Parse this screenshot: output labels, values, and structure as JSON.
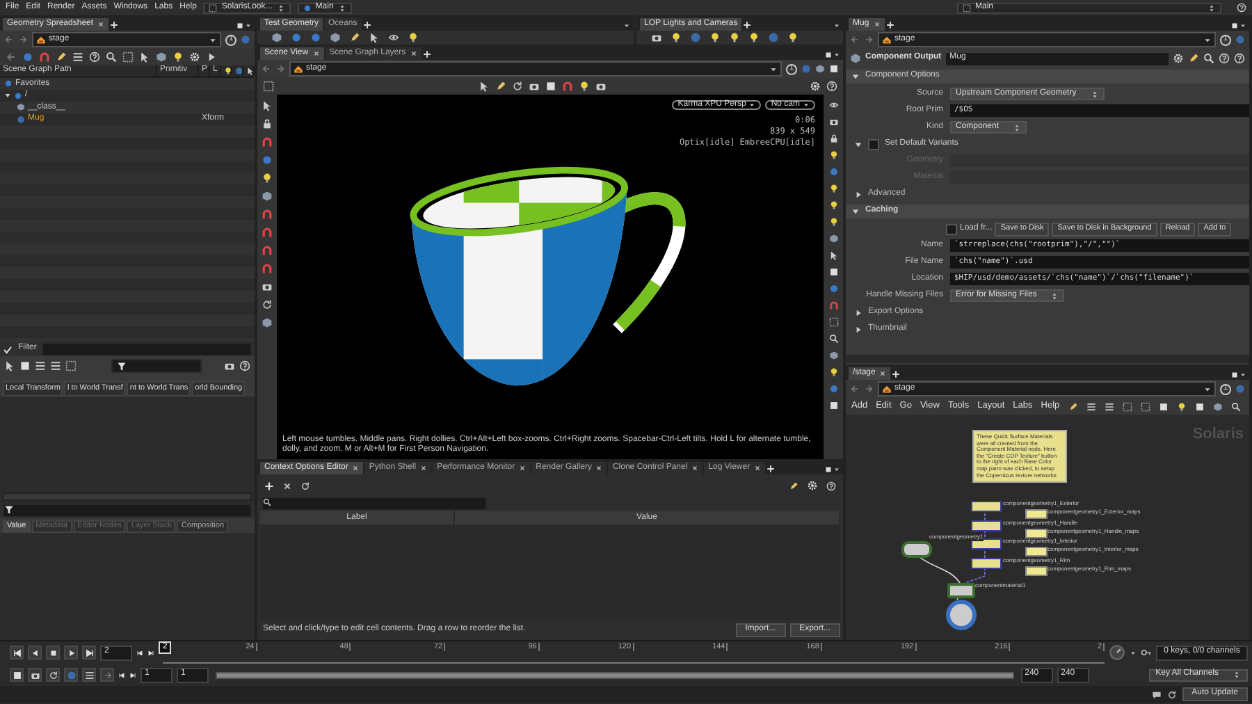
{
  "menubar": {
    "items": [
      "File",
      "Edit",
      "Render",
      "Assets",
      "Windows",
      "Labs",
      "Help"
    ],
    "desktop": "SolarisLook...",
    "context": "Main",
    "context_right": "Main"
  },
  "scene_graph": {
    "tabs": [
      {
        "label": "Geometry Spreadsheet",
        "selected": true
      }
    ],
    "path": "stage",
    "path_badge": "1",
    "columns": [
      "Scene Graph Path",
      "Primitiv",
      "P",
      "L"
    ],
    "tree": [
      {
        "label": "Favorites",
        "highlighted": false
      },
      {
        "label": "/",
        "highlighted": false,
        "children": [
          {
            "label": "__class__",
            "highlighted": false
          },
          {
            "label": "Mug",
            "type": "Xform",
            "highlighted": true
          }
        ]
      }
    ],
    "filter_label": "Filter"
  },
  "inspector": {
    "columns": [
      "Local Transform",
      "l to World Transf",
      "nt to World Trans",
      "orld Bounding"
    ],
    "tabs": [
      {
        "label": "Value",
        "selected": true,
        "disabled": false
      },
      {
        "label": "Metadata",
        "selected": false,
        "disabled": true
      },
      {
        "label": "Editor Nodes",
        "selected": false,
        "disabled": true
      },
      {
        "label": "Layer Stack",
        "selected": false,
        "disabled": true
      },
      {
        "label": "Composition",
        "selected": false,
        "disabled": false
      }
    ]
  },
  "shelves": [
    {
      "tabs": [
        {
          "label": "Test Geometry",
          "selected": true
        },
        {
          "label": "Oceans",
          "selected": false
        }
      ]
    },
    {
      "tabs": [
        {
          "label": "LOP Lights and Cameras",
          "selected": true
        }
      ]
    }
  ],
  "viewer": {
    "tabs": [
      {
        "label": "Scene View",
        "selected": true
      },
      {
        "label": "Scene Graph Layers",
        "selected": false
      }
    ],
    "path": "stage",
    "path_badge": "1",
    "renderer": "Karma XPU  Persp",
    "camera": "No cam",
    "stats": [
      "0:06",
      "839 x 549",
      "Optix[idle] EmbreeCPU[idle]"
    ],
    "hint": "Left mouse tumbles. Middle pans. Right dollies. Ctrl+Alt+Left box-zooms. Ctrl+Right zooms. Spacebar-Ctrl-Left tilts. Hold L for alternate tumble, dolly, and zoom. M or Alt+M for First Person Navigation."
  },
  "context_options": {
    "tabs": [
      {
        "label": "Context Options Editor",
        "selected": true
      },
      {
        "label": "Python Shell",
        "selected": false
      },
      {
        "label": "Performance Monitor",
        "selected": false
      },
      {
        "label": "Render Gallery",
        "selected": false
      },
      {
        "label": "Clone Control Panel",
        "selected": false
      },
      {
        "label": "Log Viewer",
        "selected": false
      }
    ],
    "columns": [
      "Label",
      "Value"
    ],
    "status": "Select and click/type to edit cell contents. Drag a row to reorder the list.",
    "buttons": [
      "Import...",
      "Export..."
    ]
  },
  "parameters": {
    "tabs": [
      {
        "label": "Mug",
        "selected": true
      }
    ],
    "path": "stage",
    "path_badge": "1",
    "node_type": "Component Output",
    "node_name": "Mug",
    "sections": [
      {
        "title": "Component Options",
        "expanded": true,
        "rows": [
          {
            "kind": "menu",
            "label": "Source",
            "value": "Upstream Component Geometry"
          },
          {
            "kind": "text",
            "label": "Root Prim",
            "value": "/$OS",
            "disabled": false
          },
          {
            "kind": "menu",
            "label": "Kind",
            "value": "Component"
          },
          {
            "kind": "subsection",
            "title": "Set Default Variants",
            "expanded": true,
            "checked": false
          },
          {
            "kind": "text",
            "label": "Geometry",
            "disabled": true
          },
          {
            "kind": "text",
            "label": "Material",
            "disabled": true
          },
          {
            "kind": "folder",
            "title": "Advanced",
            "expanded": false
          }
        ]
      },
      {
        "title": "Caching",
        "expanded": true,
        "rows": [
          {
            "kind": "buttons",
            "check_label": "Load fr...",
            "checked": false,
            "buttons": [
              "Save to Disk",
              "Save to Disk in Background",
              "Reload",
              "Add to"
            ]
          },
          {
            "kind": "text",
            "label": "Name",
            "value": "`strreplace(chs(\"rootprim\"),\"/\",\"\")`",
            "disabled": false
          },
          {
            "kind": "text",
            "label": "File Name",
            "value": "`chs(\"name\")`.usd",
            "disabled": false
          },
          {
            "kind": "text",
            "label": "Location",
            "value": "$HIP/usd/demo/assets/`chs(\"name\")`/`chs(\"filename\")`",
            "disabled": false
          },
          {
            "kind": "menu",
            "label": "Handle Missing Files",
            "value": "Error for Missing Files"
          },
          {
            "kind": "folder",
            "title": "Export Options",
            "expanded": false
          },
          {
            "kind": "folder",
            "title": "Thumbnail",
            "expanded": false
          }
        ]
      }
    ]
  },
  "network": {
    "tabs": [
      {
        "label": "/stage",
        "selected": true
      }
    ],
    "path": "stage",
    "path_badge": "1",
    "menu": [
      "Add",
      "Edit",
      "Go",
      "View",
      "Tools",
      "Layout",
      "Labs",
      "Help"
    ],
    "context_label": "Solaris",
    "note": "These Quick Surface Materials were all created from the Component Material node. Here the \"Create COP Texture\" button to the right of each Base Color map parm was clicked, to setup the Copernicus texture networks.",
    "nodes": [
      {
        "kind": "material",
        "label": "componentgeometry1_Exterior",
        "maps": "componentgeometry1_Exterior_maps"
      },
      {
        "kind": "material",
        "label": "componentgeometry1_Handle",
        "maps": "componentgeometry1_Handle_maps"
      },
      {
        "kind": "material",
        "label": "componentgeometry1_Interior",
        "maps": "componentgeometry1_Interior_maps"
      },
      {
        "kind": "material",
        "label": "componentgeometry1_Rim",
        "maps": "componentgeometry1_Rim_maps"
      },
      {
        "kind": "geometry",
        "label": "componentgeometry1"
      },
      {
        "kind": "component_material",
        "label": "componentmaterial1"
      },
      {
        "kind": "output"
      }
    ]
  },
  "timeline": {
    "frame": "2",
    "playhead": "2",
    "ticks": [
      "24",
      "48",
      "72",
      "96",
      "120",
      "144",
      "168",
      "192",
      "216",
      "2"
    ],
    "start": "1",
    "range_start": "1",
    "range": {
      "level": 1
    },
    "range_end": "240",
    "end": "240",
    "keys": "0 keys, 0/0 channels",
    "key_button": "Key All Channels",
    "update": "Auto Update"
  }
}
